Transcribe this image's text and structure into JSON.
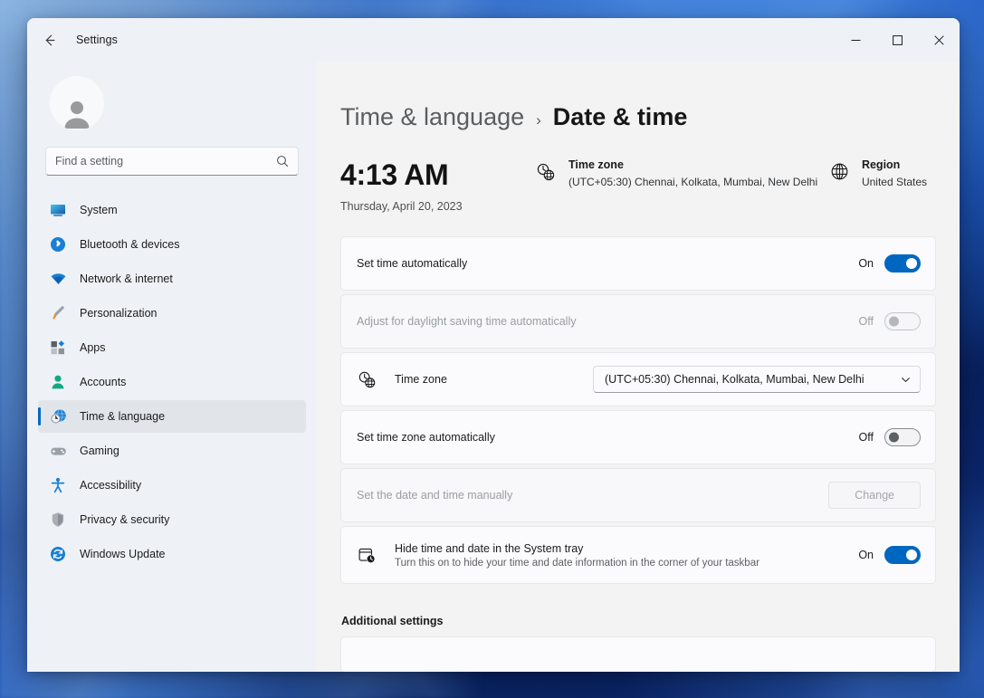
{
  "window": {
    "title": "Settings",
    "back_icon": "back-arrow-icon",
    "minimize": "–",
    "maximize": "□",
    "close": "✕"
  },
  "sidebar": {
    "search": {
      "placeholder": "Find a setting",
      "value": "",
      "icon": "search-icon"
    },
    "avatar": "user-avatar-icon",
    "items": [
      {
        "label": "System",
        "icon": "system-icon",
        "selected": false
      },
      {
        "label": "Bluetooth & devices",
        "icon": "bluetooth-icon",
        "selected": false
      },
      {
        "label": "Network & internet",
        "icon": "wifi-icon",
        "selected": false
      },
      {
        "label": "Personalization",
        "icon": "paintbrush-icon",
        "selected": false
      },
      {
        "label": "Apps",
        "icon": "apps-icon",
        "selected": false
      },
      {
        "label": "Accounts",
        "icon": "accounts-icon",
        "selected": false
      },
      {
        "label": "Time & language",
        "icon": "clock-globe-icon",
        "selected": true
      },
      {
        "label": "Gaming",
        "icon": "gamepad-icon",
        "selected": false
      },
      {
        "label": "Accessibility",
        "icon": "accessibility-icon",
        "selected": false
      },
      {
        "label": "Privacy & security",
        "icon": "shield-icon",
        "selected": false
      },
      {
        "label": "Windows Update",
        "icon": "update-icon",
        "selected": false
      }
    ]
  },
  "breadcrumb": {
    "parent": "Time & language",
    "separator": "›",
    "current": "Date & time"
  },
  "summary": {
    "time": "4:13 AM",
    "date": "Thursday, April 20, 2023",
    "timezone": {
      "icon": "clock-globe-icon",
      "title": "Time zone",
      "value": "(UTC+05:30) Chennai, Kolkata, Mumbai, New Delhi"
    },
    "region": {
      "icon": "globe-icon",
      "title": "Region",
      "value": "United States"
    }
  },
  "settings": {
    "set_time_automatically": {
      "title": "Set time automatically",
      "state_label": "On",
      "state": "on"
    },
    "adjust_dst": {
      "title": "Adjust for daylight saving time automatically",
      "state_label": "Off",
      "state": "off"
    },
    "time_zone": {
      "icon": "clock-globe-icon",
      "title": "Time zone",
      "selected": "(UTC+05:30) Chennai, Kolkata, Mumbai, New Delhi",
      "chevron": "chevron-down-icon"
    },
    "set_time_zone_automatically": {
      "title": "Set time zone automatically",
      "state_label": "Off",
      "state": "off"
    },
    "set_manually": {
      "title": "Set the date and time manually",
      "button_label": "Change"
    },
    "hide_time_date": {
      "icon": "calendar-clock-icon",
      "title": "Hide time and date in the System tray",
      "description": "Turn this on to hide your time and date information in the corner of your taskbar",
      "state_label": "On",
      "state": "on"
    }
  },
  "additional": {
    "heading": "Additional settings"
  },
  "colors": {
    "accent": "#0067c0",
    "window_bg": "#f3f3f3",
    "sidebar_bg": "#eef2f7",
    "card_bg": "#fbfbfd",
    "selected_nav": "#e1e5ea"
  }
}
